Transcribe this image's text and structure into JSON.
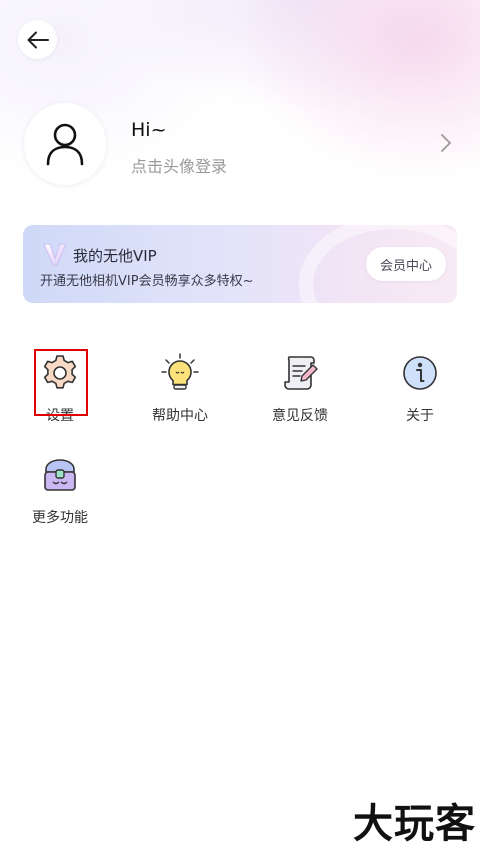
{
  "header": {
    "back_icon": "arrow-left-icon"
  },
  "profile": {
    "greeting": "Hi~",
    "login_hint": "点击头像登录",
    "avatar_icon": "user-icon",
    "chevron_icon": "chevron-right-icon"
  },
  "vip": {
    "title": "我的无他VIP",
    "subtitle": "开通无他相机VIP会员畅享众多特权~",
    "button_label": "会员中心",
    "logo_icon": "vip-v-logo-icon",
    "accent": "#c9b6f2"
  },
  "features": [
    {
      "label": "设置",
      "icon": "gear-icon"
    },
    {
      "label": "帮助中心",
      "icon": "lightbulb-icon"
    },
    {
      "label": "意见反馈",
      "icon": "feedback-scroll-icon"
    },
    {
      "label": "关于",
      "icon": "info-icon"
    },
    {
      "label": "更多功能",
      "icon": "treasure-chest-icon"
    }
  ],
  "watermark": "大玩客"
}
